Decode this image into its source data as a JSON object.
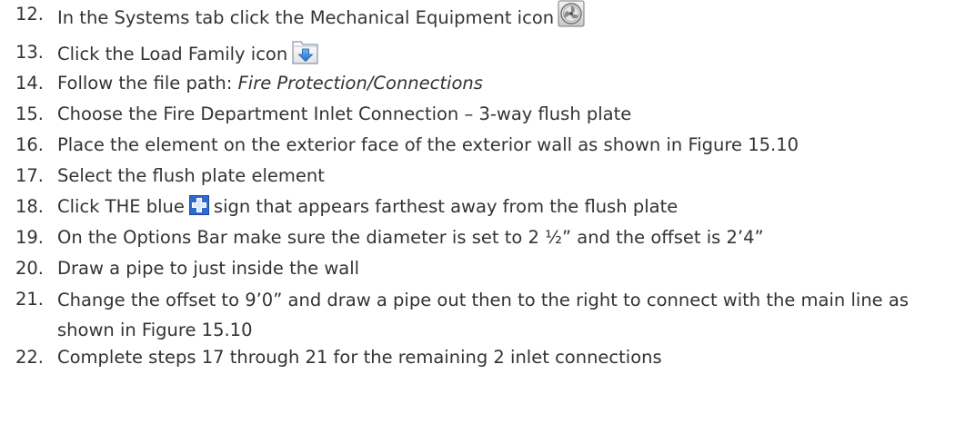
{
  "steps": [
    {
      "num": "12.",
      "text": "In the Systems tab click the Mechanical Equipment icon",
      "icon": "mechanical-equipment-icon"
    },
    {
      "num": "13.",
      "text": "Click the Load Family icon",
      "icon": "load-family-icon"
    },
    {
      "num": "14.",
      "text_prefix": "Follow the file path: ",
      "text_italic": "Fire Protection/Connections"
    },
    {
      "num": "15.",
      "text": "Choose the Fire Department Inlet Connection – 3-way flush plate"
    },
    {
      "num": "16.",
      "text": "Place the element on the exterior face of the exterior wall as shown in Figure 15.10"
    },
    {
      "num": "17.",
      "text": "Select the flush plate element"
    },
    {
      "num": "18.",
      "text_before": "Click THE blue",
      "text_after": "sign that appears farthest away from the flush plate",
      "icon": "blue-plus-icon"
    },
    {
      "num": "19.",
      "text": "On the Options Bar make sure the diameter is set to 2 ½” and the offset is 2’4”"
    },
    {
      "num": "20.",
      "text": "Draw a pipe to just inside the wall"
    },
    {
      "num": "21.",
      "text": "Change the offset to 9’0” and draw a pipe out then to the right to connect with the main line as shown in Figure 15.10"
    },
    {
      "num": "22.",
      "text": "Complete steps 17 through 21 for the remaining 2 inlet connections"
    }
  ]
}
